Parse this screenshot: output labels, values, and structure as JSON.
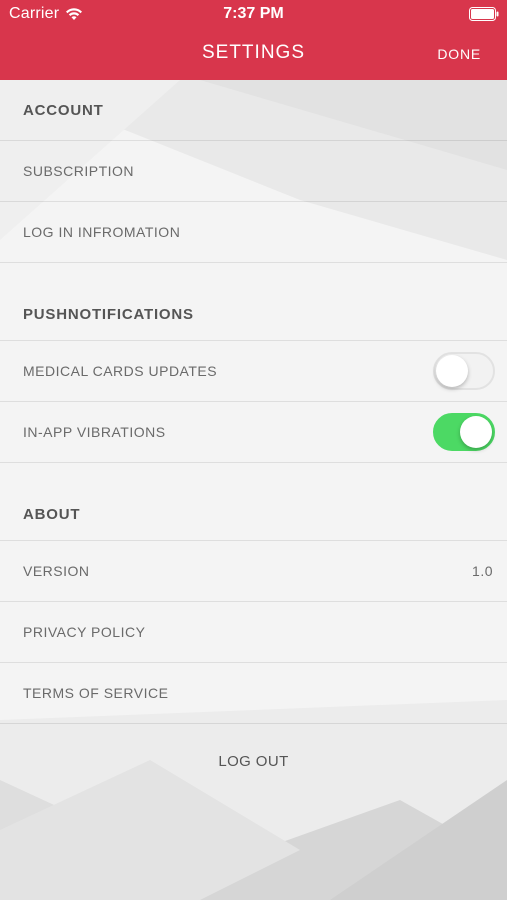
{
  "status_bar": {
    "carrier": "Carrier",
    "time": "7:37 PM",
    "wifi_icon": "wifi-icon",
    "battery_icon": "battery-icon"
  },
  "nav": {
    "title": "SETTINGS",
    "done_label": "DONE",
    "bar_color": "#d8364c"
  },
  "sections": {
    "account": {
      "title": "ACCOUNT",
      "items": [
        {
          "label": "SUBSCRIPTION"
        },
        {
          "label": "LOG IN INFROMATION"
        }
      ]
    },
    "push": {
      "title": "PUSHNOTIFICATIONS",
      "items": [
        {
          "label": "MEDICAL CARDS UPDATES",
          "toggle_on": false
        },
        {
          "label": "IN-APP VIBRATIONS",
          "toggle_on": true
        }
      ]
    },
    "about": {
      "title": "ABOUT",
      "items": [
        {
          "label": "VERSION",
          "value": "1.0"
        },
        {
          "label": "PRIVACY POLICY"
        },
        {
          "label": "TERMS OF SERVICE"
        }
      ]
    }
  },
  "logout_label": "LOG OUT",
  "toggle_on_color": "#4cd964"
}
